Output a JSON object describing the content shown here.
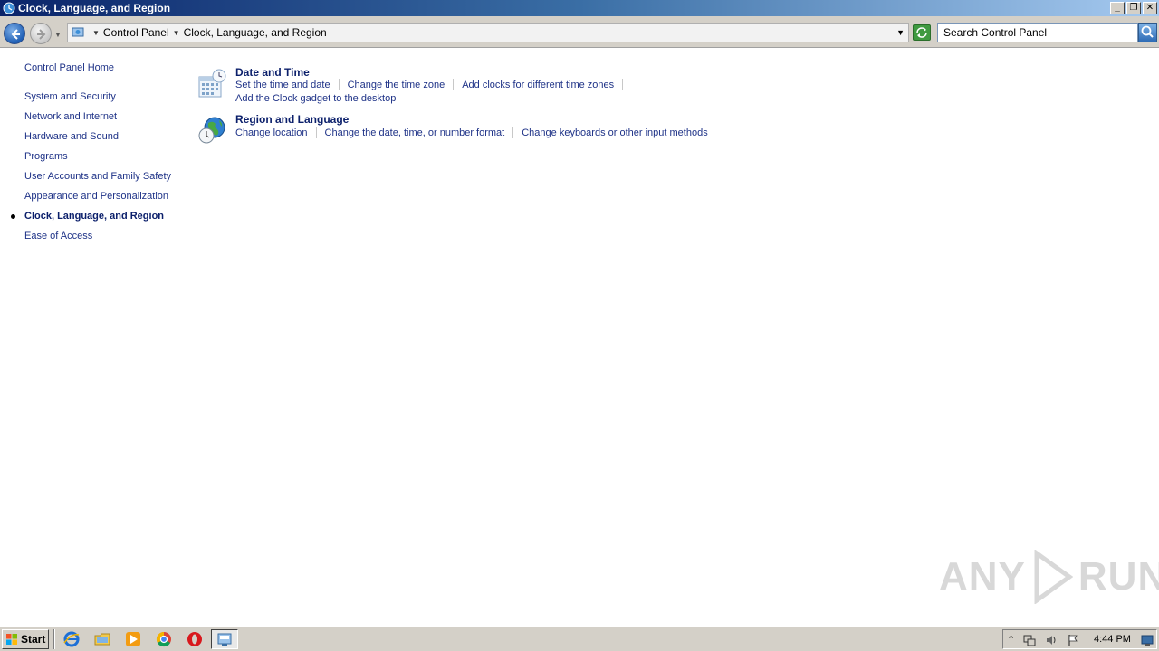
{
  "window": {
    "title": "Clock, Language, and Region",
    "buttons": {
      "minimize": "_",
      "restore": "❐",
      "close": "✕"
    }
  },
  "address_bar": {
    "breadcrumbs": [
      "Control Panel",
      "Clock, Language, and Region"
    ],
    "search_placeholder": "Search Control Panel"
  },
  "left_nav": {
    "home": "Control Panel Home",
    "items": [
      "System and Security",
      "Network and Internet",
      "Hardware and Sound",
      "Programs",
      "User Accounts and Family Safety",
      "Appearance and Personalization",
      "Clock, Language, and Region",
      "Ease of Access"
    ],
    "active_item": "Clock, Language, and Region"
  },
  "categories": [
    {
      "title": "Date and Time",
      "icon": "calendar-clock-icon",
      "links": [
        "Set the time and date",
        "Change the time zone",
        "Add clocks for different time zones"
      ],
      "extra_link": "Add the Clock gadget to the desktop"
    },
    {
      "title": "Region and Language",
      "icon": "globe-clock-icon",
      "links": [
        "Change location",
        "Change the date, time, or number format",
        "Change keyboards or other input methods"
      ]
    }
  ],
  "watermark": {
    "left": "ANY",
    "right": "RUN"
  },
  "taskbar": {
    "start_label": "Start",
    "pinned": [
      "internet-explorer-icon",
      "explorer-folder-icon",
      "media-player-icon",
      "chrome-icon",
      "opera-icon",
      "control-panel-icon"
    ],
    "clock": "4:44 PM"
  },
  "colors": {
    "link": "#1e3287",
    "heading": "#0b1f6b",
    "titlebar_start": "#0a246a",
    "titlebar_end": "#a6caf0",
    "chrome": "#d4d0c8"
  }
}
